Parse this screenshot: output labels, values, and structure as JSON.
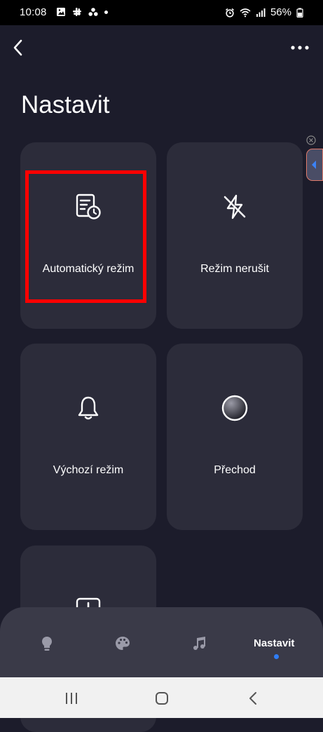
{
  "status_bar": {
    "time": "10:08",
    "battery": "56%",
    "icons_left": [
      "gallery-icon",
      "slack-icon",
      "asana-icon",
      "dot-icon"
    ],
    "icons_right": [
      "alarm-icon",
      "wifi-icon",
      "signal-icon",
      "battery-icon"
    ]
  },
  "header": {
    "title": "Nastavit",
    "back_icon": "chevron-left-icon",
    "menu_icon": "more-horizontal-icon"
  },
  "tiles": [
    {
      "label": "Automatický režim",
      "icon": "schedule-document-icon",
      "highlighted": true
    },
    {
      "label": "Režim nerušit",
      "icon": "flash-off-icon"
    },
    {
      "label": "Výchozí režim",
      "icon": "bell-icon"
    },
    {
      "label": "Přechod",
      "icon": "gradient-circle-icon"
    },
    {
      "label": "",
      "icon": "alert-box-icon"
    }
  ],
  "bottom_nav": {
    "items": [
      {
        "icon": "lightbulb-icon"
      },
      {
        "icon": "palette-icon"
      },
      {
        "icon": "music-icon"
      },
      {
        "label": "Nastavit",
        "active": true
      }
    ]
  },
  "colors": {
    "background": "#1c1c2b",
    "tile": "#2c2c3a",
    "highlight": "#ff0000",
    "accent": "#2f7df6",
    "nav_bar": "#3a3a48"
  }
}
